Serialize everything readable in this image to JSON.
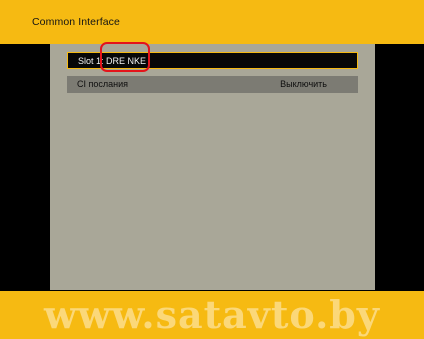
{
  "header": {
    "title": "Common Interface"
  },
  "menu": {
    "items": [
      {
        "label": "Slot 1: DRE NKE",
        "value": ""
      },
      {
        "label": "CI послания",
        "value": "Выключить"
      }
    ]
  },
  "watermark": {
    "text": "www.satavto.by"
  },
  "colors": {
    "accent": "#f6ba12",
    "panel": "#a9a798",
    "row": "#7c7b73",
    "selected_row": "#070707",
    "annotation": "#e4141b"
  }
}
